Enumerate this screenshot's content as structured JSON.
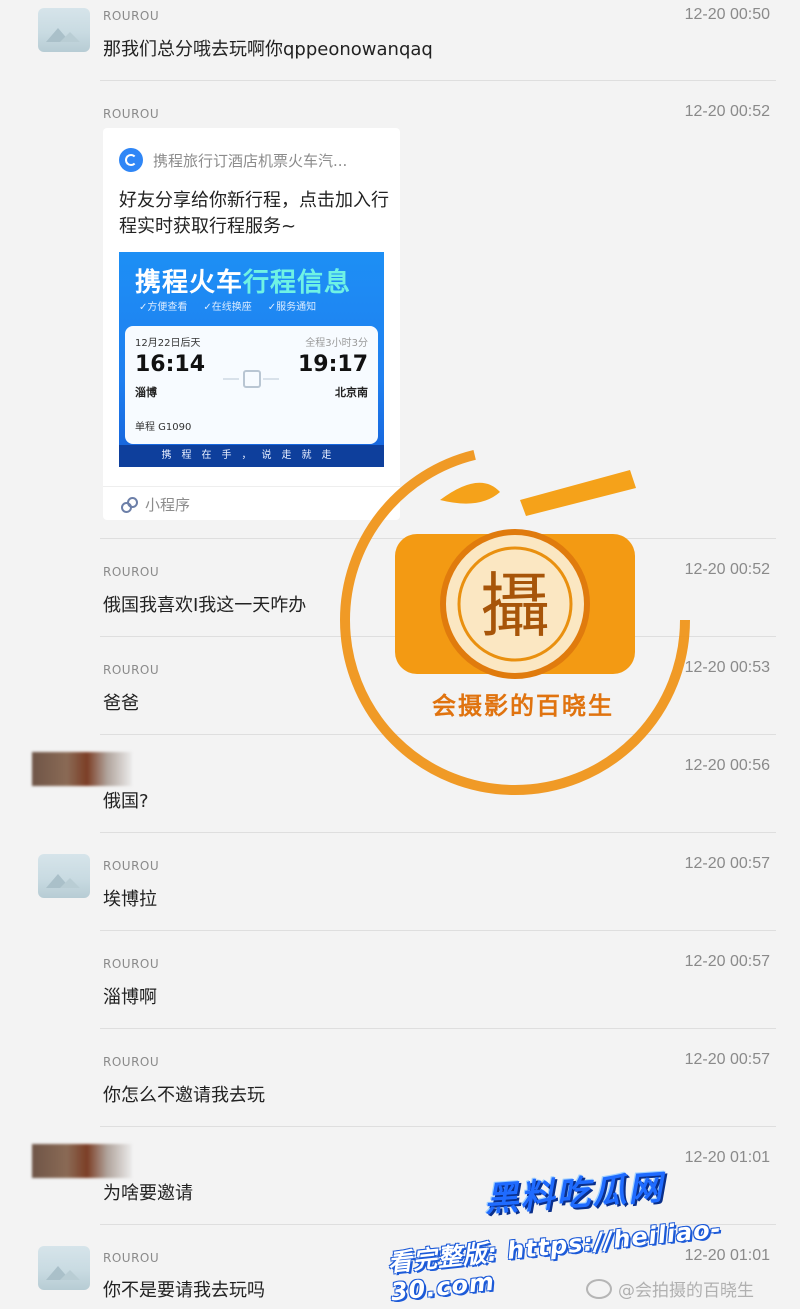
{
  "messages": [
    {
      "sender": "ROUROU",
      "time": "12-20 00:50",
      "text": "那我们总分哦去玩啊你qppeonowanqaq"
    },
    {
      "sender": "ROUROU",
      "time": "12-20 00:52",
      "text": ""
    },
    {
      "sender": "ROUROU",
      "time": "12-20 00:52",
      "text": "俄国我喜欢I我这一天咋办"
    },
    {
      "sender": "ROUROU",
      "time": "12-20 00:53",
      "text": "爸爸"
    },
    {
      "sender": "",
      "time": "12-20 00:56",
      "text": "俄国?"
    },
    {
      "sender": "ROUROU",
      "time": "12-20 00:57",
      "text": "埃博拉"
    },
    {
      "sender": "ROUROU",
      "time": "12-20 00:57",
      "text": "淄博啊"
    },
    {
      "sender": "ROUROU",
      "time": "12-20 00:57",
      "text": "你怎么不邀请我去玩"
    },
    {
      "sender": "",
      "time": "12-20 01:01",
      "text": "为啥要邀请"
    },
    {
      "sender": "ROUROU",
      "time": "12-20 01:01",
      "text": "你不是要请我去玩吗"
    }
  ],
  "card": {
    "source": "携程旅行订酒店机票火车汽...",
    "description": "好友分享给你新行程，点击加入行程实时获取行程服务~",
    "image": {
      "title_main": "携程火车",
      "title_highlight": "行程信息",
      "tags": [
        "✓方便查看",
        "✓在线换座",
        "✓服务通知"
      ],
      "date": "12月22日后天",
      "duration": "全程3小时3分",
      "depart_time": "16:14",
      "arrive_time": "19:17",
      "depart_station": "淄博",
      "arrive_station": "北京南",
      "trip": "单程 G1090",
      "footer": "携程在手，说走就走"
    },
    "mini_program_label": "小程序"
  },
  "watermark": {
    "logo_char": "攝",
    "caption": "会摄影的百晓生",
    "site_line1": "黑料吃瓜网",
    "site_line2": "看完整版: https://heiliao-30.com",
    "weibo": "@会拍摄的百晓生"
  },
  "colors": {
    "background": "#f3f3f3",
    "watermark_orange": "#f0900f",
    "site_blue": "#1f6bff"
  }
}
